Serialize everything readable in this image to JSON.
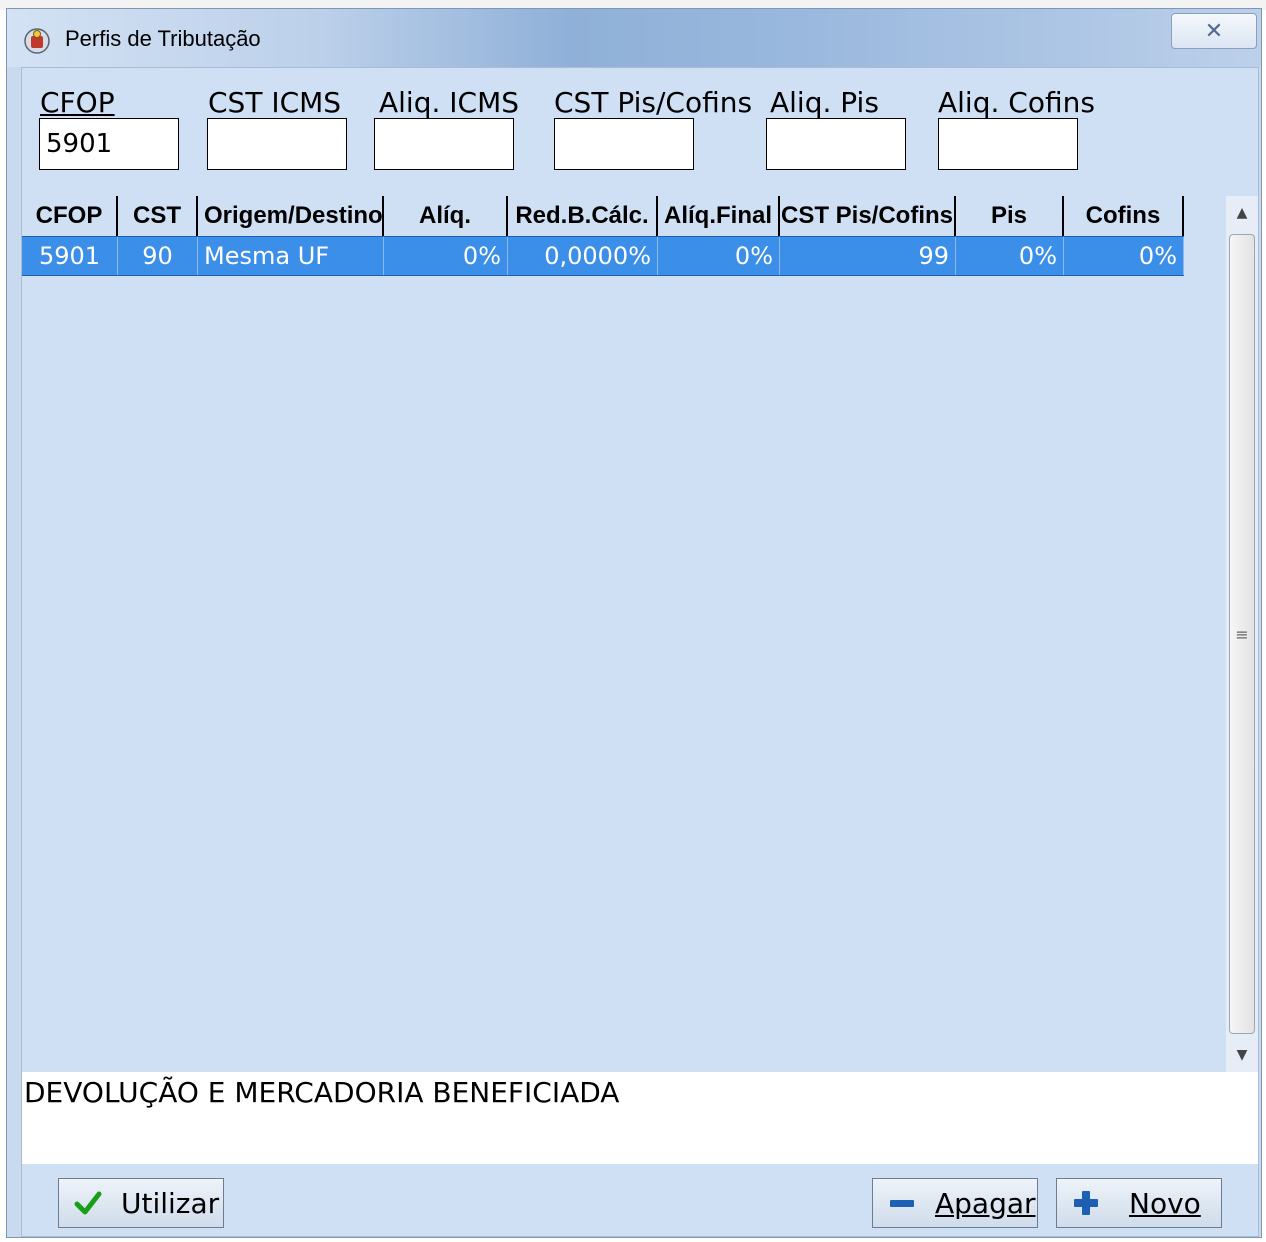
{
  "window": {
    "title": "Perfis de Tributação",
    "close_glyph": "✕"
  },
  "filters": [
    {
      "label": "CFOP",
      "value": "5901"
    },
    {
      "label": "CST ICMS",
      "value": ""
    },
    {
      "label": "Aliq. ICMS",
      "value": ""
    },
    {
      "label": "CST Pis/Cofins",
      "value": ""
    },
    {
      "label": "Aliq. Pis",
      "value": ""
    },
    {
      "label": "Aliq. Cofins",
      "value": ""
    }
  ],
  "grid": {
    "columns": [
      "CFOP",
      "CST",
      "Origem/Destino",
      "Alíq.",
      "Red.B.Cálc.",
      "Alíq.Final",
      "CST Pis/Cofins",
      "Pis",
      "Cofins"
    ],
    "rows": [
      {
        "cfop": "5901",
        "cst": "90",
        "origem": "Mesma UF",
        "aliq": "0%",
        "red": "0,0000%",
        "aliq_final": "0%",
        "cst_pis": "99",
        "pis": "0%",
        "cofins": "0%"
      }
    ]
  },
  "description": "DEVOLUÇÃO E MERCADORIA BENEFICIADA",
  "buttons": {
    "utilizar": "Utilizar",
    "apagar": "Apagar",
    "novo": "Novo"
  },
  "icons": {
    "app": "app-icon",
    "check": "check-icon",
    "minus": "minus-icon",
    "plus": "plus-icon"
  },
  "colors": {
    "selection": "#3b8fe8",
    "background": "#cfe0f4"
  }
}
